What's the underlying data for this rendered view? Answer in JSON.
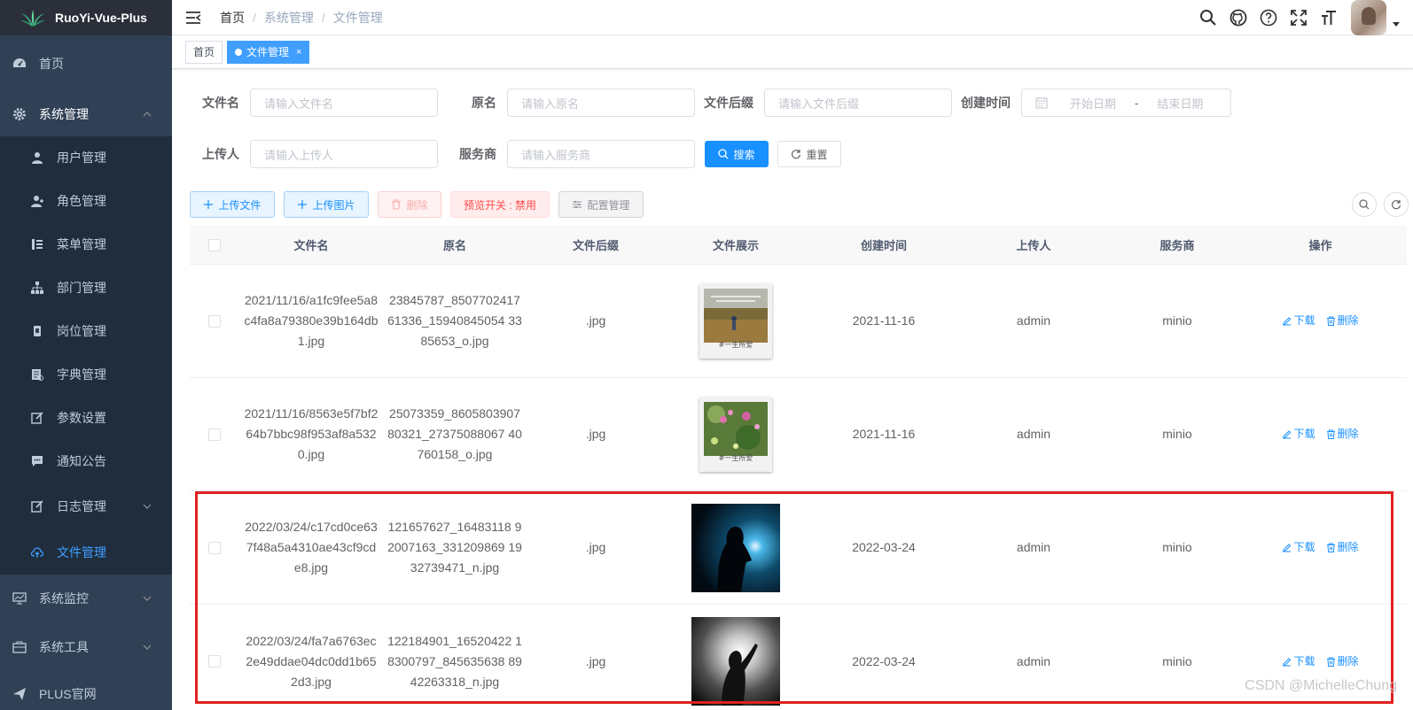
{
  "app": {
    "title": "RuoYi-Vue-Plus"
  },
  "sidebar": {
    "items": [
      {
        "label": "首页",
        "icon": "dashboard-icon"
      },
      {
        "label": "系统管理",
        "icon": "gear-icon",
        "open": true
      },
      {
        "label": "系统监控",
        "icon": "monitor-icon"
      },
      {
        "label": "系统工具",
        "icon": "tool-icon"
      },
      {
        "label": "PLUS官网",
        "icon": "send-icon"
      }
    ],
    "sub_items": [
      {
        "label": "用户管理",
        "icon": "user-icon"
      },
      {
        "label": "角色管理",
        "icon": "role-icon"
      },
      {
        "label": "菜单管理",
        "icon": "menu-tree-icon"
      },
      {
        "label": "部门管理",
        "icon": "org-tree-icon"
      },
      {
        "label": "岗位管理",
        "icon": "post-icon"
      },
      {
        "label": "字典管理",
        "icon": "dict-icon"
      },
      {
        "label": "参数设置",
        "icon": "edit-icon"
      },
      {
        "label": "通知公告",
        "icon": "message-icon"
      },
      {
        "label": "日志管理",
        "icon": "log-icon"
      },
      {
        "label": "文件管理",
        "icon": "upload-cloud-icon",
        "active": true
      }
    ]
  },
  "breadcrumb": [
    "首页",
    "系统管理",
    "文件管理"
  ],
  "breadcrumb_sep": "/",
  "tags": [
    {
      "label": "首页"
    },
    {
      "label": "文件管理",
      "active": true,
      "close": "×"
    }
  ],
  "search": {
    "filename_label": "文件名",
    "filename_placeholder": "请输入文件名",
    "original_label": "原名",
    "original_placeholder": "请输入原名",
    "suffix_label": "文件后缀",
    "suffix_placeholder": "请输入文件后缀",
    "created_label": "创建时间",
    "start_placeholder": "开始日期",
    "range_sep": "-",
    "end_placeholder": "结束日期",
    "uploader_label": "上传人",
    "uploader_placeholder": "请输入上传人",
    "service_label": "服务商",
    "service_placeholder": "请输入服务商",
    "search_button": "搜索",
    "reset_button": "重置"
  },
  "toolbar": {
    "upload_file": "上传文件",
    "upload_image": "上传图片",
    "delete": "删除",
    "preview_toggle": "预览开关 : 禁用",
    "config": "配置管理"
  },
  "table": {
    "headers": [
      "文件名",
      "原名",
      "文件后缀",
      "文件展示",
      "创建时间",
      "上传人",
      "服务商",
      "操作"
    ],
    "rows": [
      {
        "file_name": "2021/11/16/a1fc9fee5a8c4fa8a79380e39b164db1.jpg",
        "original_name": "23845787_850770241761336_15940845054 3385653_o.jpg",
        "suffix": ".jpg",
        "created": "2021-11-16",
        "uploader": "admin",
        "service": "minio",
        "preview_caption": "#一生所爱",
        "preview_type": "polaroid-field"
      },
      {
        "file_name": "2021/11/16/8563e5f7bf264b7bbc98f953af8a5320.jpg",
        "original_name": "25073359_860580390780321_27375088067 40760158_o.jpg",
        "suffix": ".jpg",
        "created": "2021-11-16",
        "uploader": "admin",
        "service": "minio",
        "preview_caption": "#一生所爱",
        "preview_type": "polaroid-flower"
      },
      {
        "file_name": "2022/03/24/c17cd0ce637f48a5a4310ae43cf9cde8.jpg",
        "original_name": "121657627_16483118 92007163_331209869 1932739471_n.jpg",
        "suffix": ".jpg",
        "created": "2022-03-24",
        "uploader": "admin",
        "service": "minio",
        "preview_type": "photo-blue"
      },
      {
        "file_name": "2022/03/24/fa7a6763ec2e49ddae04dc0dd1b652d3.jpg",
        "original_name": "122184901_16520422 18300797_845635638 8942263318_n.jpg",
        "suffix": ".jpg",
        "created": "2022-03-24",
        "uploader": "admin",
        "service": "minio",
        "preview_type": "photo-bw"
      }
    ],
    "ops": {
      "download": "下载",
      "delete": "删除"
    }
  },
  "watermark": "CSDN @MichelleChung",
  "colors": {
    "sidebar_bg": "#304156",
    "primary": "#1890ff",
    "highlight": "#e02020"
  }
}
